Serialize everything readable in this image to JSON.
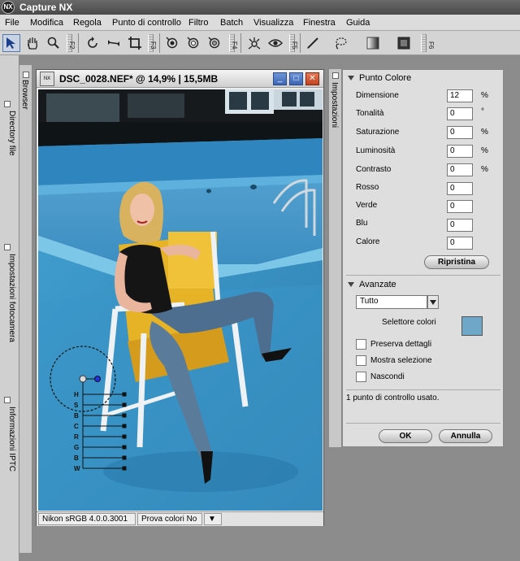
{
  "app": {
    "logo": "NX",
    "title": "Capture  NX"
  },
  "menu": [
    "File",
    "Modifica",
    "Regola",
    "Punto di controllo",
    "Filtro",
    "Batch",
    "Visualizza",
    "Finestra",
    "Guida"
  ],
  "toolbar": {
    "fkeys": [
      "F2",
      "F3",
      "F4",
      "F5",
      "F6"
    ],
    "icons": [
      "select-arrow-icon",
      "hand-icon",
      "zoom-icon",
      "rotate-icon",
      "straighten-icon",
      "crop-icon",
      "black-point-icon",
      "white-point-icon",
      "neutral-point-icon",
      "red-eye-icon",
      "eye-icon",
      "brush-icon",
      "lasso-icon",
      "gradient-icon",
      "fill-icon"
    ]
  },
  "left_tabs": [
    "Directory file",
    "Impostazioni fotocamera",
    "Informazioni IPTC"
  ],
  "browser_tab": "Browser",
  "image_window": {
    "title": "DSC_0028.NEF* @ 14,9% | 15,5MB",
    "icon_text": "NX",
    "status": {
      "profile": "Nikon sRGB 4.0.0.3001",
      "proof": "Prova colori No"
    },
    "control_point": {
      "sliders": [
        "H",
        "S",
        "B",
        "C",
        "R",
        "G",
        "B",
        "W"
      ]
    }
  },
  "settings_tab": "Impostazioni",
  "panel": {
    "section1": {
      "title": "Punto Colore",
      "properties": [
        {
          "label": "Dimensione",
          "value": "12",
          "unit": "%"
        },
        {
          "label": "Tonalità",
          "value": "0",
          "unit": "°"
        },
        {
          "label": "Saturazione",
          "value": "0",
          "unit": "%"
        },
        {
          "label": "Luminosità",
          "value": "0",
          "unit": "%"
        },
        {
          "label": "Contrasto",
          "value": "0",
          "unit": "%"
        },
        {
          "label": "Rosso",
          "value": "0",
          "unit": ""
        },
        {
          "label": "Verde",
          "value": "0",
          "unit": ""
        },
        {
          "label": "Blu",
          "value": "0",
          "unit": ""
        },
        {
          "label": "Calore",
          "value": "0",
          "unit": ""
        }
      ],
      "reset": "Ripristina"
    },
    "section2": {
      "title": "Avanzate",
      "select_value": "Tutto",
      "color_selector_label": "Selettore colori",
      "color": "#6fa7c9",
      "checkboxes": [
        "Preserva dettagli",
        "Mostra selezione",
        "Nascondi"
      ]
    },
    "info": "1 punto di controllo usato.",
    "ok": "OK",
    "cancel": "Annulla"
  }
}
